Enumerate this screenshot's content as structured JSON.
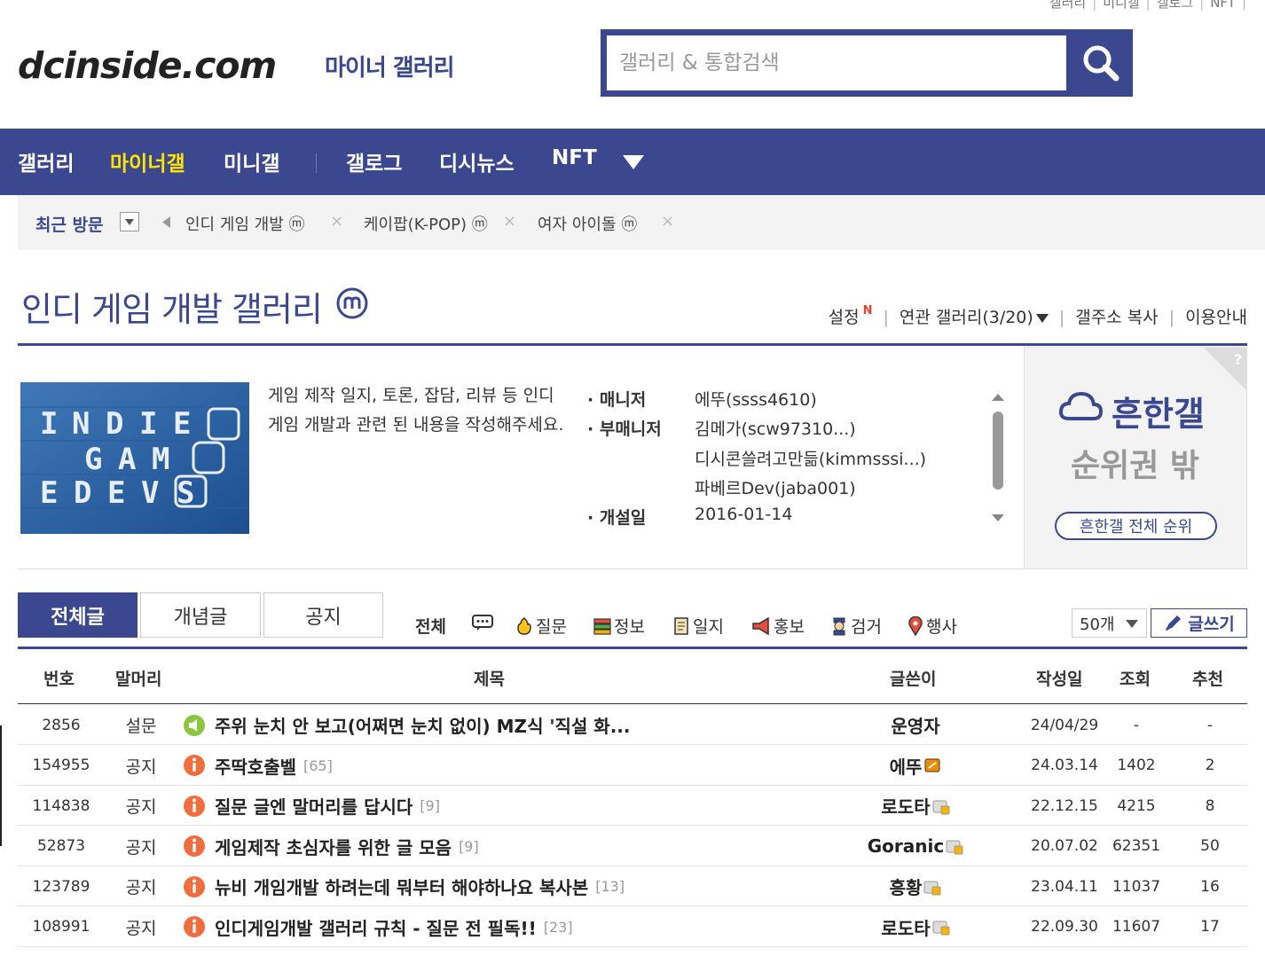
{
  "top_util": [
    "갤러리",
    "미니갤",
    "갤로그",
    "NFT"
  ],
  "header": {
    "logo": "dcinside.com",
    "logo_sub": "마이너 갤러리",
    "search_placeholder": "갤러리 & 통합검색"
  },
  "nav": [
    "갤러리",
    "마이너갤",
    "미니갤",
    "갤로그",
    "디시뉴스",
    "NFT"
  ],
  "recent": {
    "title": "최근 방문",
    "items": [
      "인디 게임 개발 ⓜ",
      "케이팝(K-POP) ⓜ",
      "여자 아이돌 ⓜ"
    ]
  },
  "gallery": {
    "title": "인디 게임 개발 갤러리",
    "links": [
      "설정",
      "연관 갤러리(3/20)",
      "갤주소 복사",
      "이용안내"
    ],
    "new_badge": "N",
    "description": "게임 제작 일지, 토론, 잡담, 리뷰 등 인디 게임 개발과 관련 된 내용을 작성해주세요.",
    "thumb_letters": [
      "I",
      "N",
      "D",
      "I",
      "E",
      "G",
      "A",
      "M",
      "E",
      "D",
      "E",
      "V",
      "S"
    ],
    "manager_label": "매니저",
    "manager": "에뚜(ssss4610)",
    "sub_manager_label": "부매니저",
    "sub_managers": [
      "김메가(scw97310...)",
      "디시콘쓸려고만듦(kimmsssi...)",
      "파베르Dev(jaba001)"
    ],
    "open_label": "개설일",
    "open_date": "2016-01-14"
  },
  "ranking": {
    "title": "흔한갤",
    "subtitle": "순위권 밖",
    "button": "흔한갤 전체 순위",
    "help": "?"
  },
  "tabs": [
    "전체글",
    "개념글",
    "공지"
  ],
  "categories": [
    "전체",
    "질문",
    "정보",
    "일지",
    "홍보",
    "검거",
    "행사"
  ],
  "per_page": "50개",
  "write_button": "글쓰기",
  "table": {
    "headers": [
      "번호",
      "말머리",
      "제목",
      "글쓴이",
      "작성일",
      "조회",
      "추천"
    ],
    "rows": [
      {
        "no": "2856",
        "head": "설문",
        "title": "주위 눈치 안 보고(어쩌면 눈치 없이) MZ식 '직설 화...",
        "count": "",
        "writer": "운영자",
        "date": "24/04/29",
        "views": "-",
        "rec": "-"
      },
      {
        "no": "154955",
        "head": "공지",
        "title": "주딱호출벨",
        "count": "[65]",
        "writer": "에뚜",
        "date": "24.03.14",
        "views": "1402",
        "rec": "2"
      },
      {
        "no": "114838",
        "head": "공지",
        "title": "질문 글엔 말머리를 답시다",
        "count": "[9]",
        "writer": "로도타",
        "date": "22.12.15",
        "views": "4215",
        "rec": "8"
      },
      {
        "no": "52873",
        "head": "공지",
        "title": "게임제작 초심자를 위한 글 모음",
        "count": "[9]",
        "writer": "Goranic",
        "date": "20.07.02",
        "views": "62351",
        "rec": "50"
      },
      {
        "no": "123789",
        "head": "공지",
        "title": "뉴비 개임개발 하려는데 뭐부터 해야하나요 복사본",
        "count": "[13]",
        "writer": "흥황",
        "date": "23.04.11",
        "views": "11037",
        "rec": "16"
      },
      {
        "no": "108991",
        "head": "공지",
        "title": "인디게임개발 갤러리 규칙 - 질문 전 필독!!",
        "count": "[23]",
        "writer": "로도타",
        "date": "22.09.30",
        "views": "11607",
        "rec": "17"
      }
    ]
  },
  "colors": {
    "brand": "#3b4890",
    "nav_active": "#ffe400",
    "notice_icon": "#f26d3d",
    "survey_icon": "#8cc63f"
  }
}
